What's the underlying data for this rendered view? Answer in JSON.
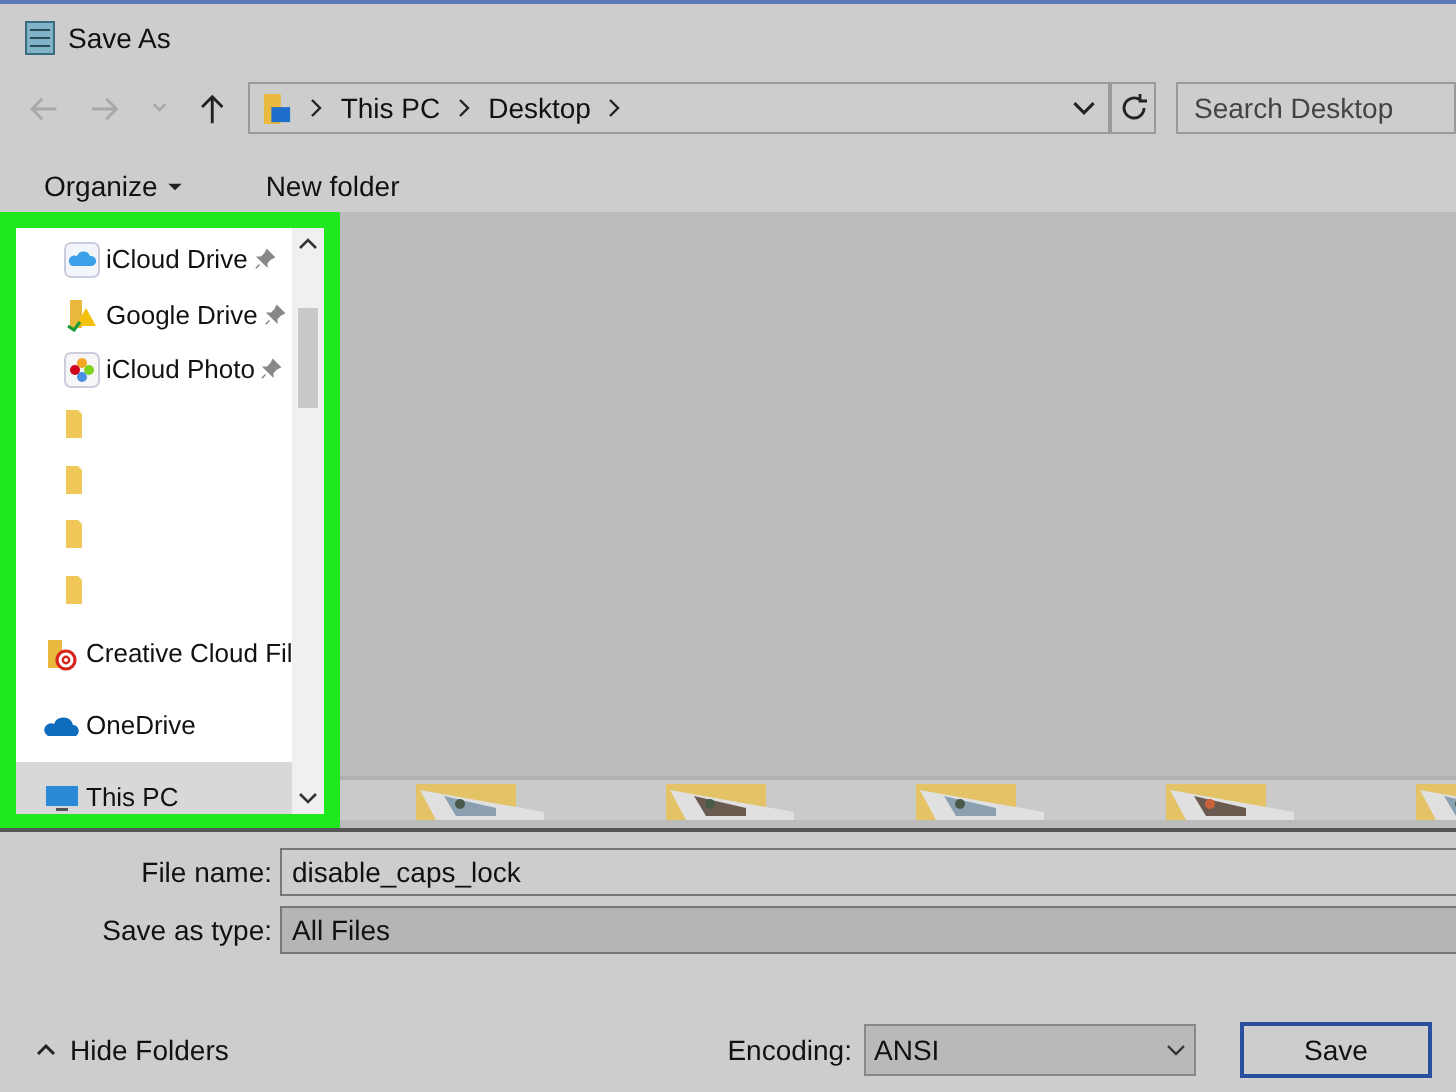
{
  "window": {
    "title": "Save As"
  },
  "nav": {
    "back_disabled": true,
    "forward_disabled": true,
    "breadcrumb": [
      "This PC",
      "Desktop"
    ],
    "search": {
      "placeholder": "Search Desktop"
    }
  },
  "toolbar": [
    {
      "label": "Organize",
      "dropdown": true
    },
    {
      "label": "New folder",
      "dropdown": false
    }
  ],
  "sidebar": {
    "highlighted": true,
    "items": [
      {
        "kind": "cloud",
        "label": "iCloud Drive",
        "pinned": true,
        "selected": false
      },
      {
        "kind": "drive",
        "label": "Google Drive",
        "pinned": true,
        "selected": false
      },
      {
        "kind": "photos",
        "label": "iCloud Photo",
        "pinned": true,
        "selected": false
      },
      {
        "kind": "folder",
        "pinned": false,
        "selected": false
      },
      {
        "kind": "folder",
        "pinned": false,
        "selected": false
      },
      {
        "kind": "folder",
        "pinned": false,
        "selected": false
      },
      {
        "kind": "folder",
        "pinned": false,
        "selected": false
      },
      {
        "kind": "creative-cloud",
        "label": "Creative Cloud Fil",
        "pinned": false,
        "selected": false
      },
      {
        "kind": "onedrive",
        "label": "OneDrive",
        "pinned": false,
        "selected": false
      },
      {
        "kind": "pc",
        "label": "This PC",
        "pinned": false,
        "selected": true
      }
    ]
  },
  "form": {
    "file_name": {
      "label": "File name:",
      "value": "disable_caps_lock"
    },
    "save_as_type": {
      "label": "Save as type:",
      "value": "All Files"
    }
  },
  "footer": {
    "hide_folders": "Hide Folders",
    "encoding": {
      "label": "Encoding:",
      "value": "ANSI"
    },
    "save": "Save"
  }
}
